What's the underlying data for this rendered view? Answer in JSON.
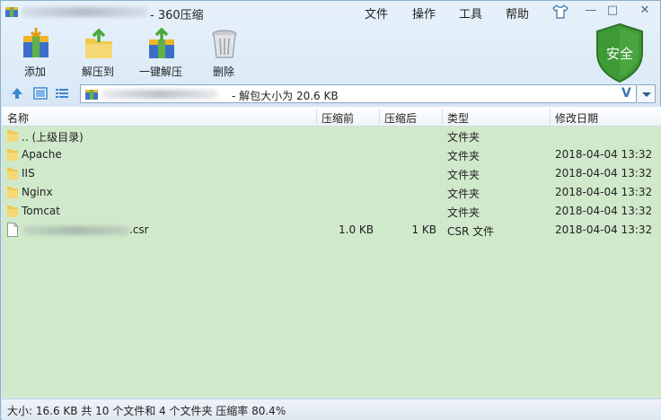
{
  "window": {
    "title": "- 360压缩",
    "menu": [
      "文件",
      "操作",
      "工具",
      "帮助"
    ],
    "controls": {
      "minimize": "—",
      "maximize": "□",
      "close": "✕"
    }
  },
  "toolbar": {
    "add": "添加",
    "extract_to": "解压到",
    "one_click_extract": "一键解压",
    "delete": "删除",
    "badge": "安全"
  },
  "address": {
    "text": "- 解包大小为 20.6 KB",
    "v_label": "V"
  },
  "columns": {
    "name": "名称",
    "before": "压缩前",
    "after": "压缩后",
    "type": "类型",
    "modified": "修改日期"
  },
  "files": [
    {
      "name": ".. (上级目录)",
      "before": "",
      "after": "",
      "type": "文件夹",
      "modified": "",
      "icon": "folder-icon"
    },
    {
      "name": "Apache",
      "before": "",
      "after": "",
      "type": "文件夹",
      "modified": "2018-04-04 13:32",
      "icon": "folder-icon"
    },
    {
      "name": "IIS",
      "before": "",
      "after": "",
      "type": "文件夹",
      "modified": "2018-04-04 13:32",
      "icon": "folder-icon"
    },
    {
      "name": "Nginx",
      "before": "",
      "after": "",
      "type": "文件夹",
      "modified": "2018-04-04 13:32",
      "icon": "folder-icon"
    },
    {
      "name": "Tomcat",
      "before": "",
      "after": "",
      "type": "文件夹",
      "modified": "2018-04-04 13:32",
      "icon": "folder-icon"
    },
    {
      "name": ".csr",
      "before": "1.0 KB",
      "after": "1 KB",
      "type": "CSR 文件",
      "modified": "2018-04-04 13:32",
      "icon": "file-icon"
    }
  ],
  "status": {
    "text": "大小: 16.6 KB 共 10 个文件和 4 个文件夹 压缩率 80.4%"
  },
  "colors": {
    "list_bg": "#d0e9cb",
    "folder": "#f2c94c",
    "shield": "#3e9a36"
  }
}
